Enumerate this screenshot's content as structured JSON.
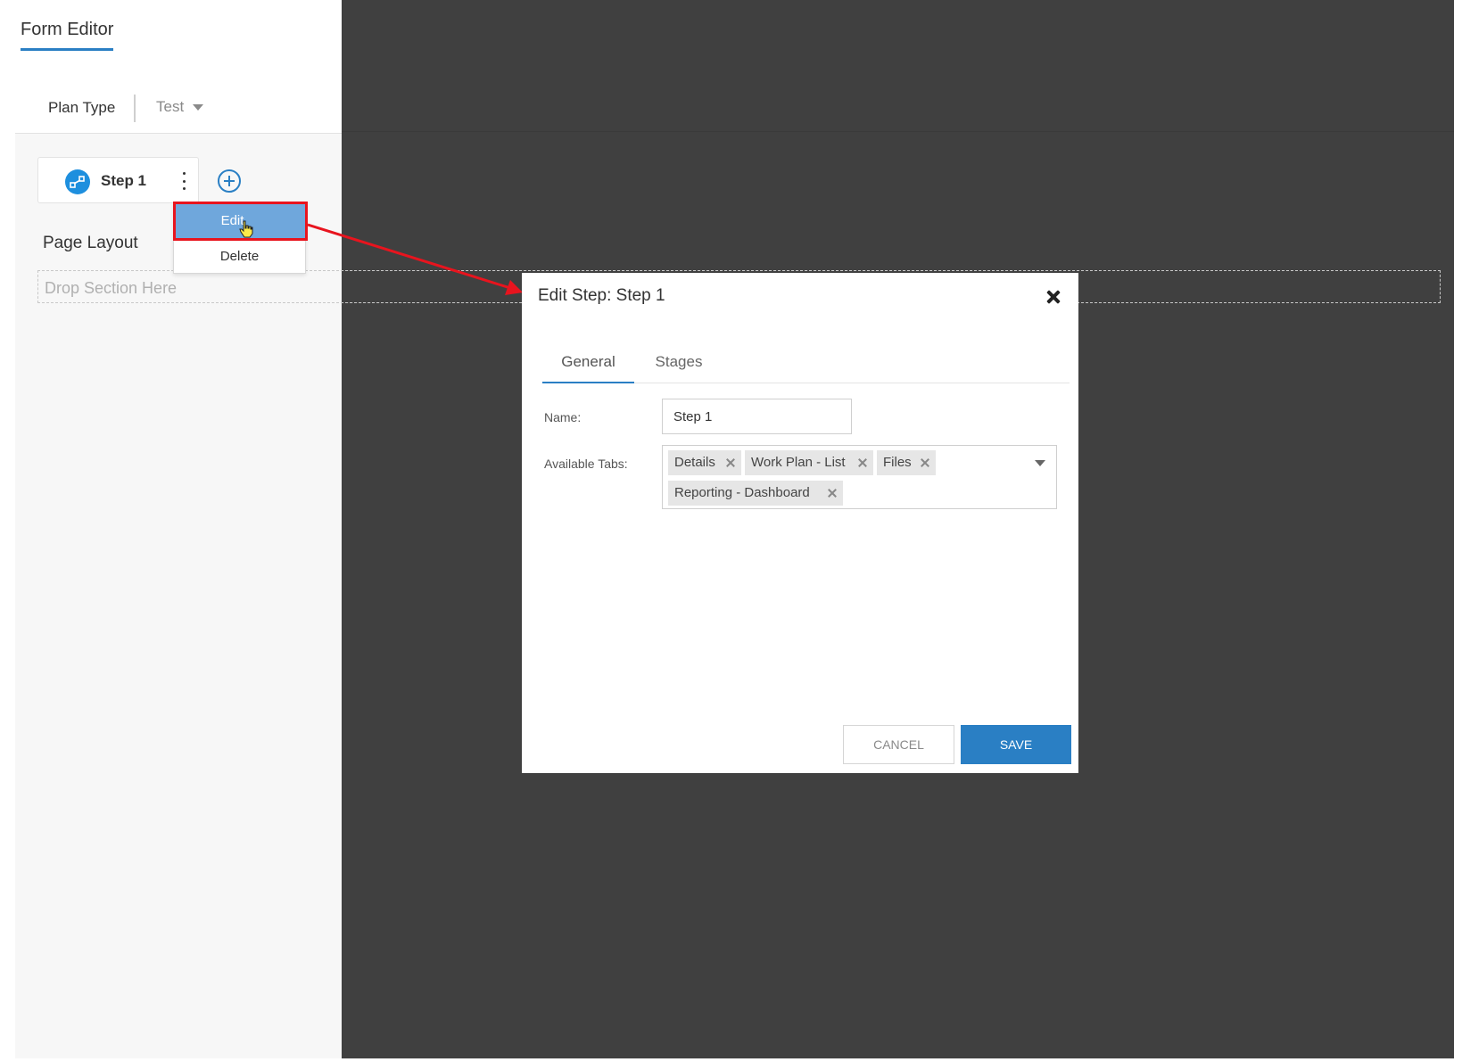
{
  "editor": {
    "title": "Form Editor",
    "plan_type_label": "Plan Type",
    "plan_type_value": "Test",
    "step_label": "Step 1",
    "page_layout_label": "Page Layout",
    "drop_zone_text": "Drop Section Here"
  },
  "context_menu": {
    "items": [
      {
        "label": "Edit"
      },
      {
        "label": "Delete"
      }
    ]
  },
  "modal": {
    "title": "Edit Step: Step 1",
    "tabs": [
      {
        "label": "General",
        "active": true
      },
      {
        "label": "Stages",
        "active": false
      }
    ],
    "name_label": "Name:",
    "name_value": "Step 1",
    "available_tabs_label": "Available Tabs:",
    "available_tabs": [
      "Details",
      "Work Plan - List",
      "Files",
      "Reporting - Dashboard"
    ],
    "cancel_label": "CANCEL",
    "save_label": "SAVE"
  },
  "colors": {
    "accent": "#2a7fc4",
    "menu_highlight": "#6fa7dc",
    "annotation_red": "#e8141e",
    "overlay": "#404040"
  }
}
